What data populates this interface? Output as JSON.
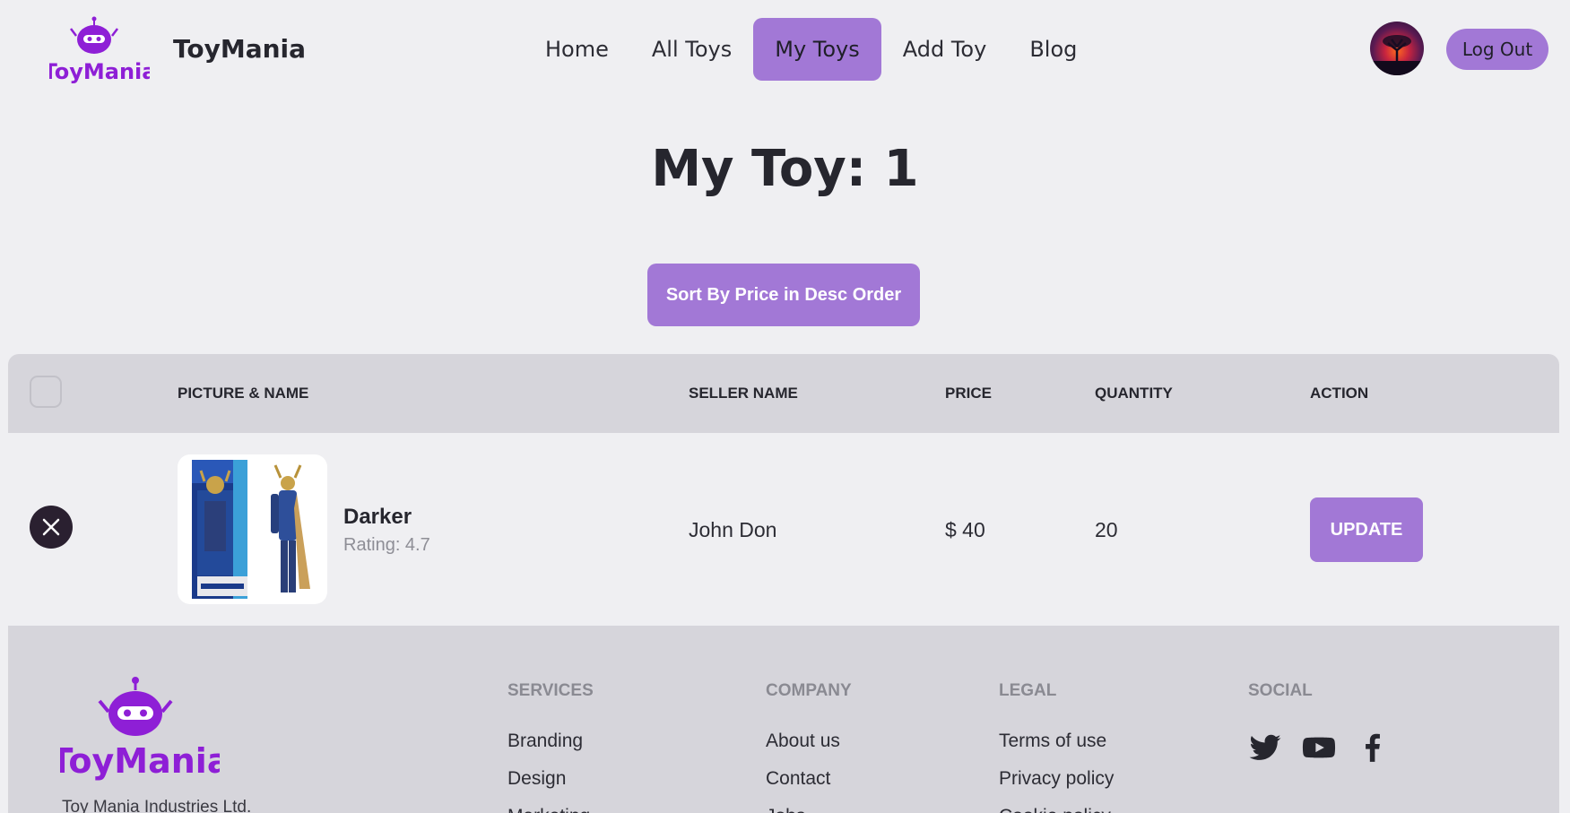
{
  "brand": {
    "logo_text": "ToyMania",
    "name": "ToyMania"
  },
  "nav": {
    "items": [
      {
        "label": "Home",
        "active": false
      },
      {
        "label": "All Toys",
        "active": false
      },
      {
        "label": "My Toys",
        "active": true
      },
      {
        "label": "Add Toy",
        "active": false
      },
      {
        "label": "Blog",
        "active": false
      }
    ],
    "logout_label": "Log Out"
  },
  "page": {
    "title": "My Toy: 1",
    "sort_button_label": "Sort By Price in Desc Order"
  },
  "table": {
    "headers": [
      "PICTURE & NAME",
      "SELLER NAME",
      "PRICE",
      "QUANTITY",
      "ACTION"
    ],
    "rows": [
      {
        "name": "Darker",
        "rating": "Rating: 4.7",
        "seller": "John Don",
        "price": "$ 40",
        "quantity": "20",
        "action_label": "UPDATE"
      }
    ]
  },
  "footer": {
    "company": "Toy Mania Industries Ltd.",
    "columns": [
      {
        "heading": "SERVICES",
        "links": [
          "Branding",
          "Design",
          "Marketing"
        ]
      },
      {
        "heading": "COMPANY",
        "links": [
          "About us",
          "Contact",
          "Jobs"
        ]
      },
      {
        "heading": "LEGAL",
        "links": [
          "Terms of use",
          "Privacy policy",
          "Cookie policy"
        ]
      }
    ],
    "social": {
      "heading": "SOCIAL",
      "icons": [
        "twitter-icon",
        "youtube-icon",
        "facebook-icon"
      ]
    }
  },
  "colors": {
    "accent": "#a278d6",
    "brand_purple": "#8e1fd6",
    "background": "#efeff2",
    "panel": "#d6d5db"
  }
}
